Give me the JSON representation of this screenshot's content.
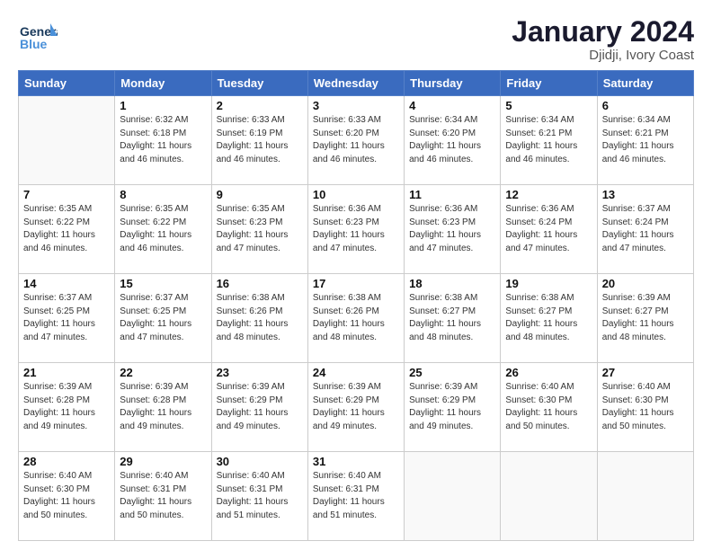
{
  "header": {
    "logo_text_general": "General",
    "logo_text_blue": "Blue",
    "month_title": "January 2024",
    "subtitle": "Djidji, Ivory Coast"
  },
  "days_of_week": [
    "Sunday",
    "Monday",
    "Tuesday",
    "Wednesday",
    "Thursday",
    "Friday",
    "Saturday"
  ],
  "weeks": [
    [
      {
        "day": "",
        "sunrise": "",
        "sunset": "",
        "daylight": ""
      },
      {
        "day": "1",
        "sunrise": "Sunrise: 6:32 AM",
        "sunset": "Sunset: 6:18 PM",
        "daylight": "Daylight: 11 hours and 46 minutes."
      },
      {
        "day": "2",
        "sunrise": "Sunrise: 6:33 AM",
        "sunset": "Sunset: 6:19 PM",
        "daylight": "Daylight: 11 hours and 46 minutes."
      },
      {
        "day": "3",
        "sunrise": "Sunrise: 6:33 AM",
        "sunset": "Sunset: 6:20 PM",
        "daylight": "Daylight: 11 hours and 46 minutes."
      },
      {
        "day": "4",
        "sunrise": "Sunrise: 6:34 AM",
        "sunset": "Sunset: 6:20 PM",
        "daylight": "Daylight: 11 hours and 46 minutes."
      },
      {
        "day": "5",
        "sunrise": "Sunrise: 6:34 AM",
        "sunset": "Sunset: 6:21 PM",
        "daylight": "Daylight: 11 hours and 46 minutes."
      },
      {
        "day": "6",
        "sunrise": "Sunrise: 6:34 AM",
        "sunset": "Sunset: 6:21 PM",
        "daylight": "Daylight: 11 hours and 46 minutes."
      }
    ],
    [
      {
        "day": "7",
        "sunrise": "Sunrise: 6:35 AM",
        "sunset": "Sunset: 6:22 PM",
        "daylight": "Daylight: 11 hours and 46 minutes."
      },
      {
        "day": "8",
        "sunrise": "Sunrise: 6:35 AM",
        "sunset": "Sunset: 6:22 PM",
        "daylight": "Daylight: 11 hours and 46 minutes."
      },
      {
        "day": "9",
        "sunrise": "Sunrise: 6:35 AM",
        "sunset": "Sunset: 6:23 PM",
        "daylight": "Daylight: 11 hours and 47 minutes."
      },
      {
        "day": "10",
        "sunrise": "Sunrise: 6:36 AM",
        "sunset": "Sunset: 6:23 PM",
        "daylight": "Daylight: 11 hours and 47 minutes."
      },
      {
        "day": "11",
        "sunrise": "Sunrise: 6:36 AM",
        "sunset": "Sunset: 6:23 PM",
        "daylight": "Daylight: 11 hours and 47 minutes."
      },
      {
        "day": "12",
        "sunrise": "Sunrise: 6:36 AM",
        "sunset": "Sunset: 6:24 PM",
        "daylight": "Daylight: 11 hours and 47 minutes."
      },
      {
        "day": "13",
        "sunrise": "Sunrise: 6:37 AM",
        "sunset": "Sunset: 6:24 PM",
        "daylight": "Daylight: 11 hours and 47 minutes."
      }
    ],
    [
      {
        "day": "14",
        "sunrise": "Sunrise: 6:37 AM",
        "sunset": "Sunset: 6:25 PM",
        "daylight": "Daylight: 11 hours and 47 minutes."
      },
      {
        "day": "15",
        "sunrise": "Sunrise: 6:37 AM",
        "sunset": "Sunset: 6:25 PM",
        "daylight": "Daylight: 11 hours and 47 minutes."
      },
      {
        "day": "16",
        "sunrise": "Sunrise: 6:38 AM",
        "sunset": "Sunset: 6:26 PM",
        "daylight": "Daylight: 11 hours and 48 minutes."
      },
      {
        "day": "17",
        "sunrise": "Sunrise: 6:38 AM",
        "sunset": "Sunset: 6:26 PM",
        "daylight": "Daylight: 11 hours and 48 minutes."
      },
      {
        "day": "18",
        "sunrise": "Sunrise: 6:38 AM",
        "sunset": "Sunset: 6:27 PM",
        "daylight": "Daylight: 11 hours and 48 minutes."
      },
      {
        "day": "19",
        "sunrise": "Sunrise: 6:38 AM",
        "sunset": "Sunset: 6:27 PM",
        "daylight": "Daylight: 11 hours and 48 minutes."
      },
      {
        "day": "20",
        "sunrise": "Sunrise: 6:39 AM",
        "sunset": "Sunset: 6:27 PM",
        "daylight": "Daylight: 11 hours and 48 minutes."
      }
    ],
    [
      {
        "day": "21",
        "sunrise": "Sunrise: 6:39 AM",
        "sunset": "Sunset: 6:28 PM",
        "daylight": "Daylight: 11 hours and 49 minutes."
      },
      {
        "day": "22",
        "sunrise": "Sunrise: 6:39 AM",
        "sunset": "Sunset: 6:28 PM",
        "daylight": "Daylight: 11 hours and 49 minutes."
      },
      {
        "day": "23",
        "sunrise": "Sunrise: 6:39 AM",
        "sunset": "Sunset: 6:29 PM",
        "daylight": "Daylight: 11 hours and 49 minutes."
      },
      {
        "day": "24",
        "sunrise": "Sunrise: 6:39 AM",
        "sunset": "Sunset: 6:29 PM",
        "daylight": "Daylight: 11 hours and 49 minutes."
      },
      {
        "day": "25",
        "sunrise": "Sunrise: 6:39 AM",
        "sunset": "Sunset: 6:29 PM",
        "daylight": "Daylight: 11 hours and 49 minutes."
      },
      {
        "day": "26",
        "sunrise": "Sunrise: 6:40 AM",
        "sunset": "Sunset: 6:30 PM",
        "daylight": "Daylight: 11 hours and 50 minutes."
      },
      {
        "day": "27",
        "sunrise": "Sunrise: 6:40 AM",
        "sunset": "Sunset: 6:30 PM",
        "daylight": "Daylight: 11 hours and 50 minutes."
      }
    ],
    [
      {
        "day": "28",
        "sunrise": "Sunrise: 6:40 AM",
        "sunset": "Sunset: 6:30 PM",
        "daylight": "Daylight: 11 hours and 50 minutes."
      },
      {
        "day": "29",
        "sunrise": "Sunrise: 6:40 AM",
        "sunset": "Sunset: 6:31 PM",
        "daylight": "Daylight: 11 hours and 50 minutes."
      },
      {
        "day": "30",
        "sunrise": "Sunrise: 6:40 AM",
        "sunset": "Sunset: 6:31 PM",
        "daylight": "Daylight: 11 hours and 51 minutes."
      },
      {
        "day": "31",
        "sunrise": "Sunrise: 6:40 AM",
        "sunset": "Sunset: 6:31 PM",
        "daylight": "Daylight: 11 hours and 51 minutes."
      },
      {
        "day": "",
        "sunrise": "",
        "sunset": "",
        "daylight": ""
      },
      {
        "day": "",
        "sunrise": "",
        "sunset": "",
        "daylight": ""
      },
      {
        "day": "",
        "sunrise": "",
        "sunset": "",
        "daylight": ""
      }
    ]
  ]
}
